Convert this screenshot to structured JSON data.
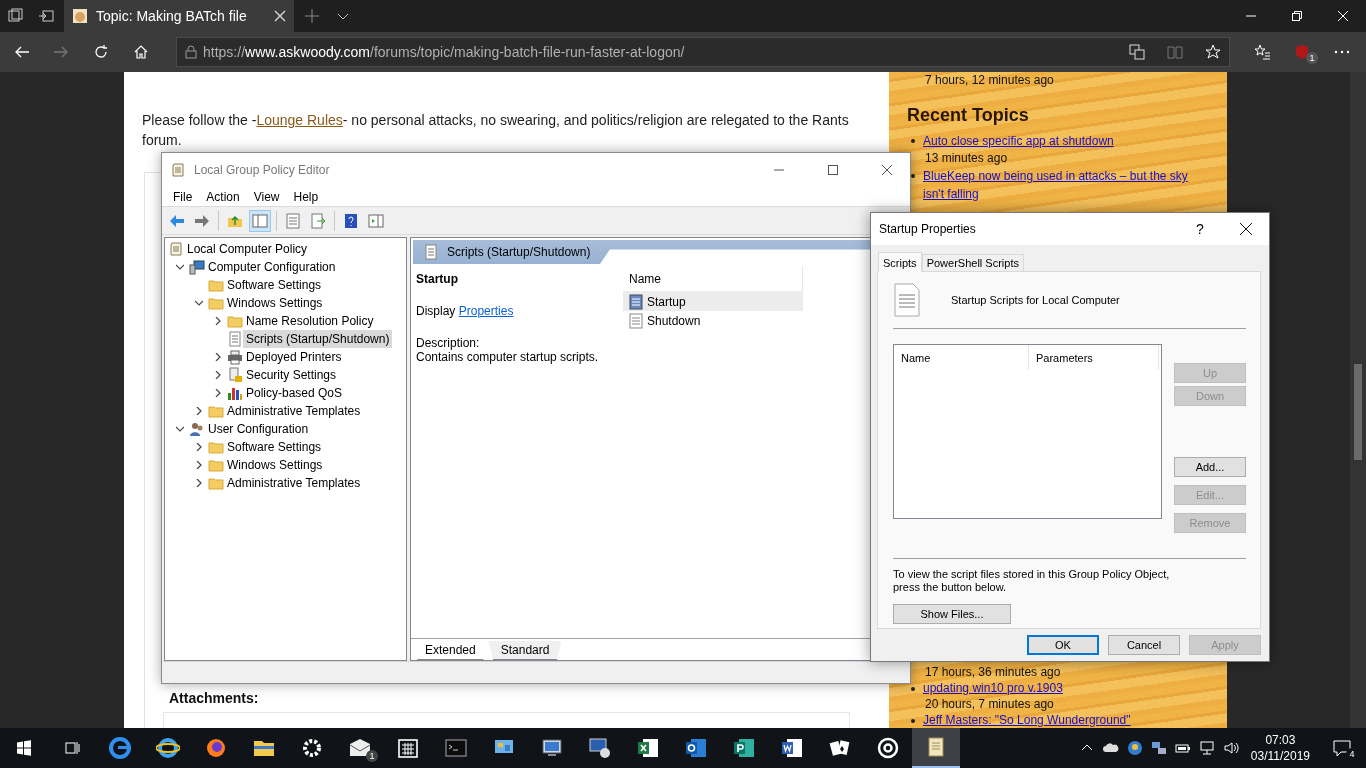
{
  "browser": {
    "tab": {
      "title": "Topic: Making BATch file"
    },
    "url": {
      "scheme": "https://",
      "domain": "www.askwoody.com",
      "path": "/forums/topic/making-batch-file-run-faster-at-logon/"
    },
    "extension_badge": "1"
  },
  "page": {
    "notice_start": "Please follow the -",
    "rules_link": "Lounge Rules",
    "notice_end": "- no personal attacks, no swearing, and politics/religion are relegated to the Rants forum.",
    "attachments_heading": "Attachments:"
  },
  "sidebar": {
    "top": [
      {
        "kind": "time",
        "text": "7 hours, 12 minutes ago"
      },
      {
        "kind": "heading",
        "text": "Recent Topics"
      },
      {
        "kind": "topic",
        "text": "Auto close specific app at shutdown"
      },
      {
        "kind": "time",
        "text": "13 minutes ago"
      },
      {
        "kind": "topic",
        "text": "BlueKeep now being used in attacks – but the sky isn't falling"
      }
    ],
    "bottom": [
      {
        "kind": "time",
        "text": "17 hours, 36 minutes ago"
      },
      {
        "kind": "topic",
        "text": "updating win10 pro v.1903"
      },
      {
        "kind": "time",
        "text": "20 hours, 7 minutes ago"
      },
      {
        "kind": "topic",
        "text": "Jeff Masters: \"So Long Wunderground\""
      }
    ]
  },
  "gpe": {
    "title": "Local Group Policy Editor",
    "menu": [
      "File",
      "Action",
      "View",
      "Help"
    ],
    "tree": [
      {
        "label": "Local Computer Policy",
        "kind": "policy",
        "selected": false,
        "children": [
          {
            "label": "Computer Configuration",
            "kind": "computer",
            "expanded": true,
            "selected": false,
            "children": [
              {
                "label": "Software Settings",
                "kind": "folder",
                "selected": false
              },
              {
                "label": "Windows Settings",
                "kind": "folder",
                "expanded": true,
                "selected": false,
                "children": [
                  {
                    "label": "Name Resolution Policy",
                    "kind": "folder",
                    "expanded": false,
                    "selected": false
                  },
                  {
                    "label": "Scripts (Startup/Shutdown)",
                    "kind": "script",
                    "selected": true
                  },
                  {
                    "label": "Deployed Printers",
                    "kind": "printer",
                    "expanded": false,
                    "selected": false
                  },
                  {
                    "label": "Security Settings",
                    "kind": "security",
                    "expanded": false,
                    "selected": false
                  },
                  {
                    "label": "Policy-based QoS",
                    "kind": "qos",
                    "expanded": false,
                    "selected": false
                  }
                ]
              },
              {
                "label": "Administrative Templates",
                "kind": "folder",
                "expanded": false,
                "selected": false
              }
            ]
          },
          {
            "label": "User Configuration",
            "kind": "user",
            "expanded": true,
            "selected": false,
            "children": [
              {
                "label": "Software Settings",
                "kind": "folder",
                "expanded": false,
                "selected": false
              },
              {
                "label": "Windows Settings",
                "kind": "folder",
                "expanded": false,
                "selected": false
              },
              {
                "label": "Administrative Templates",
                "kind": "folder",
                "expanded": false,
                "selected": false
              }
            ]
          }
        ]
      }
    ],
    "pane": {
      "header": "Scripts (Startup/Shutdown)",
      "heading": "Startup",
      "display_label": "Display",
      "display_link": "Properties",
      "description_label": "Description:",
      "description": "Contains computer startup scripts.",
      "list_column": "Name",
      "items": [
        {
          "label": "Startup",
          "kind": "startup",
          "selected": true
        },
        {
          "label": "Shutdown",
          "kind": "shutdown",
          "selected": false
        }
      ],
      "tabs": [
        {
          "label": "Extended",
          "selected": true
        },
        {
          "label": "Standard",
          "selected": false
        }
      ]
    }
  },
  "dialog": {
    "title": "Startup Properties",
    "help": "?",
    "tabs": [
      {
        "label": "Scripts",
        "selected": true
      },
      {
        "label": "PowerShell Scripts",
        "selected": false
      }
    ],
    "heading": "Startup Scripts for Local Computer",
    "columns": [
      "Name",
      "Parameters"
    ],
    "side_buttons": [
      [
        {
          "label": "Up",
          "disabled": true
        },
        {
          "label": "Down",
          "disabled": true
        }
      ],
      [
        {
          "label": "Add...",
          "disabled": false
        },
        {
          "label": "Edit...",
          "disabled": true
        },
        {
          "label": "Remove",
          "disabled": true
        }
      ]
    ],
    "note": "To view the script files stored in this Group Policy Object, press the button below.",
    "show_files": "Show Files...",
    "footer": [
      {
        "label": "OK",
        "default": true,
        "disabled": false
      },
      {
        "label": "Cancel",
        "default": false,
        "disabled": false
      },
      {
        "label": "Apply",
        "default": false,
        "disabled": true
      }
    ]
  },
  "taskbar": {
    "apps": [
      {
        "kind": "browser",
        "active": false
      },
      {
        "kind": "globe",
        "active": false
      },
      {
        "kind": "fox",
        "active": false
      },
      {
        "kind": "folder",
        "active": false
      },
      {
        "kind": "gear",
        "active": false
      },
      {
        "kind": "mail",
        "active": false,
        "badge": "1"
      },
      {
        "kind": "calendar",
        "active": false
      },
      {
        "kind": "terminal",
        "active": false
      },
      {
        "kind": "panel",
        "active": false
      },
      {
        "kind": "monitor",
        "active": false
      },
      {
        "kind": "computer",
        "active": false
      },
      {
        "kind": "sheet",
        "active": false
      },
      {
        "kind": "outlook",
        "active": false
      },
      {
        "kind": "publisher",
        "active": false
      },
      {
        "kind": "word",
        "active": false
      },
      {
        "kind": "cards",
        "active": false
      },
      {
        "kind": "disc",
        "active": false
      },
      {
        "kind": "scroll",
        "active": true
      }
    ],
    "time": "07:03",
    "date": "03/11/2019",
    "notifications": "4"
  }
}
